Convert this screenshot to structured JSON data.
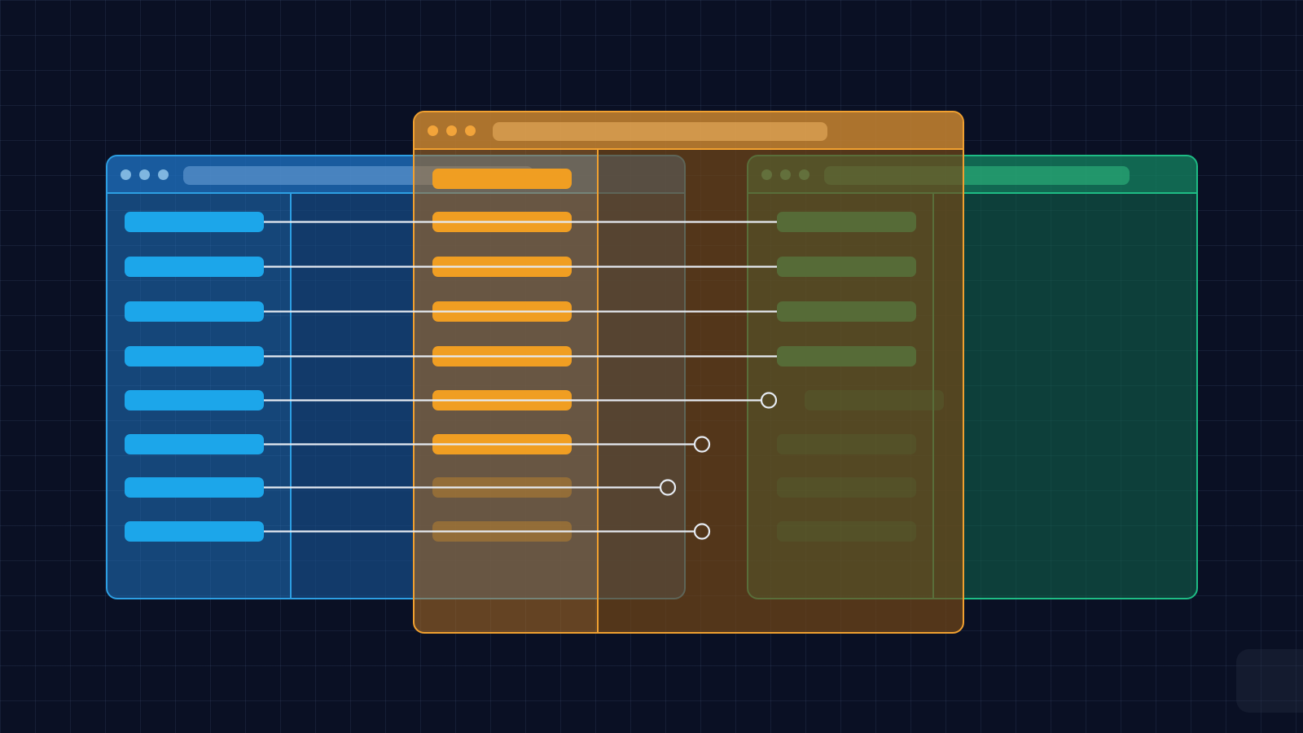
{
  "colors": {
    "background": "#0a1024",
    "blue": "#1ca6ea",
    "orange": "#f09e22",
    "green": "#12b47c",
    "link": "#e6ebf2"
  },
  "windows": [
    {
      "id": "blue",
      "icon": "browser-window-icon",
      "rows": 8,
      "active_rows": 8
    },
    {
      "id": "orange",
      "icon": "browser-window-icon",
      "rows": 9,
      "active_rows": 7
    },
    {
      "id": "green",
      "icon": "browser-window-icon",
      "rows": 8,
      "active_rows": 4
    }
  ],
  "connections": [
    {
      "row": 1,
      "reaches": "green"
    },
    {
      "row": 2,
      "reaches": "green"
    },
    {
      "row": 3,
      "reaches": "green"
    },
    {
      "row": 4,
      "reaches": "green"
    },
    {
      "row": 5,
      "reaches": "open-endpoint"
    },
    {
      "row": 6,
      "reaches": "open-endpoint"
    },
    {
      "row": 7,
      "reaches": "open-endpoint"
    },
    {
      "row": 8,
      "reaches": "open-endpoint"
    }
  ]
}
